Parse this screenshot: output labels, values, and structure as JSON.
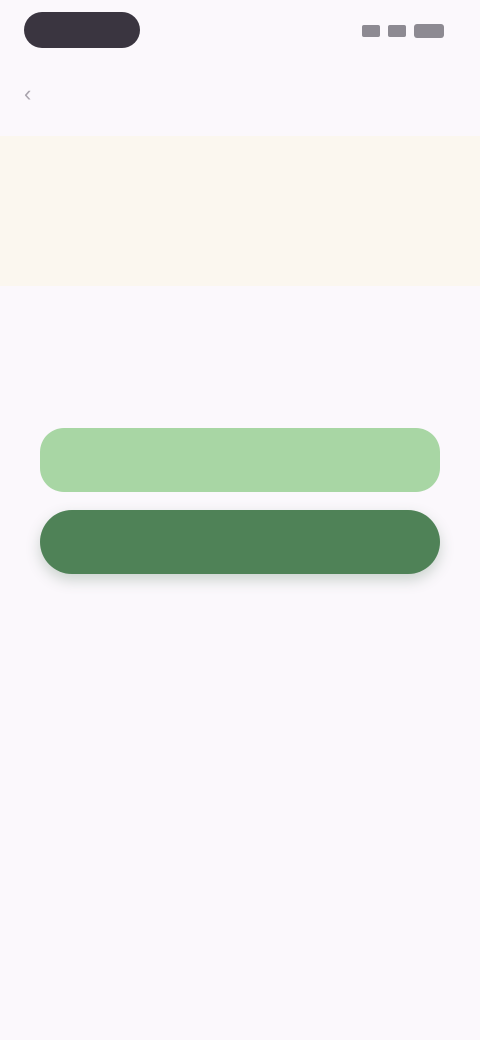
{
  "status_bar": {
    "time": "",
    "icons": [
      "signal-icon",
      "wifi-icon",
      "battery-icon"
    ]
  },
  "app_bar": {
    "back_label": "",
    "title": ""
  },
  "banner": {
    "text": "",
    "tag": ""
  },
  "content": {
    "prompt": ""
  },
  "buttons": {
    "primary_light_label": "",
    "primary_dark_label": ""
  },
  "colors": {
    "background": "#fbf8fc",
    "banner_bg": "#fbf7ef",
    "button_light": "#a8d6a4",
    "button_dark": "#4f8257",
    "status_pill": "#3a3540"
  }
}
